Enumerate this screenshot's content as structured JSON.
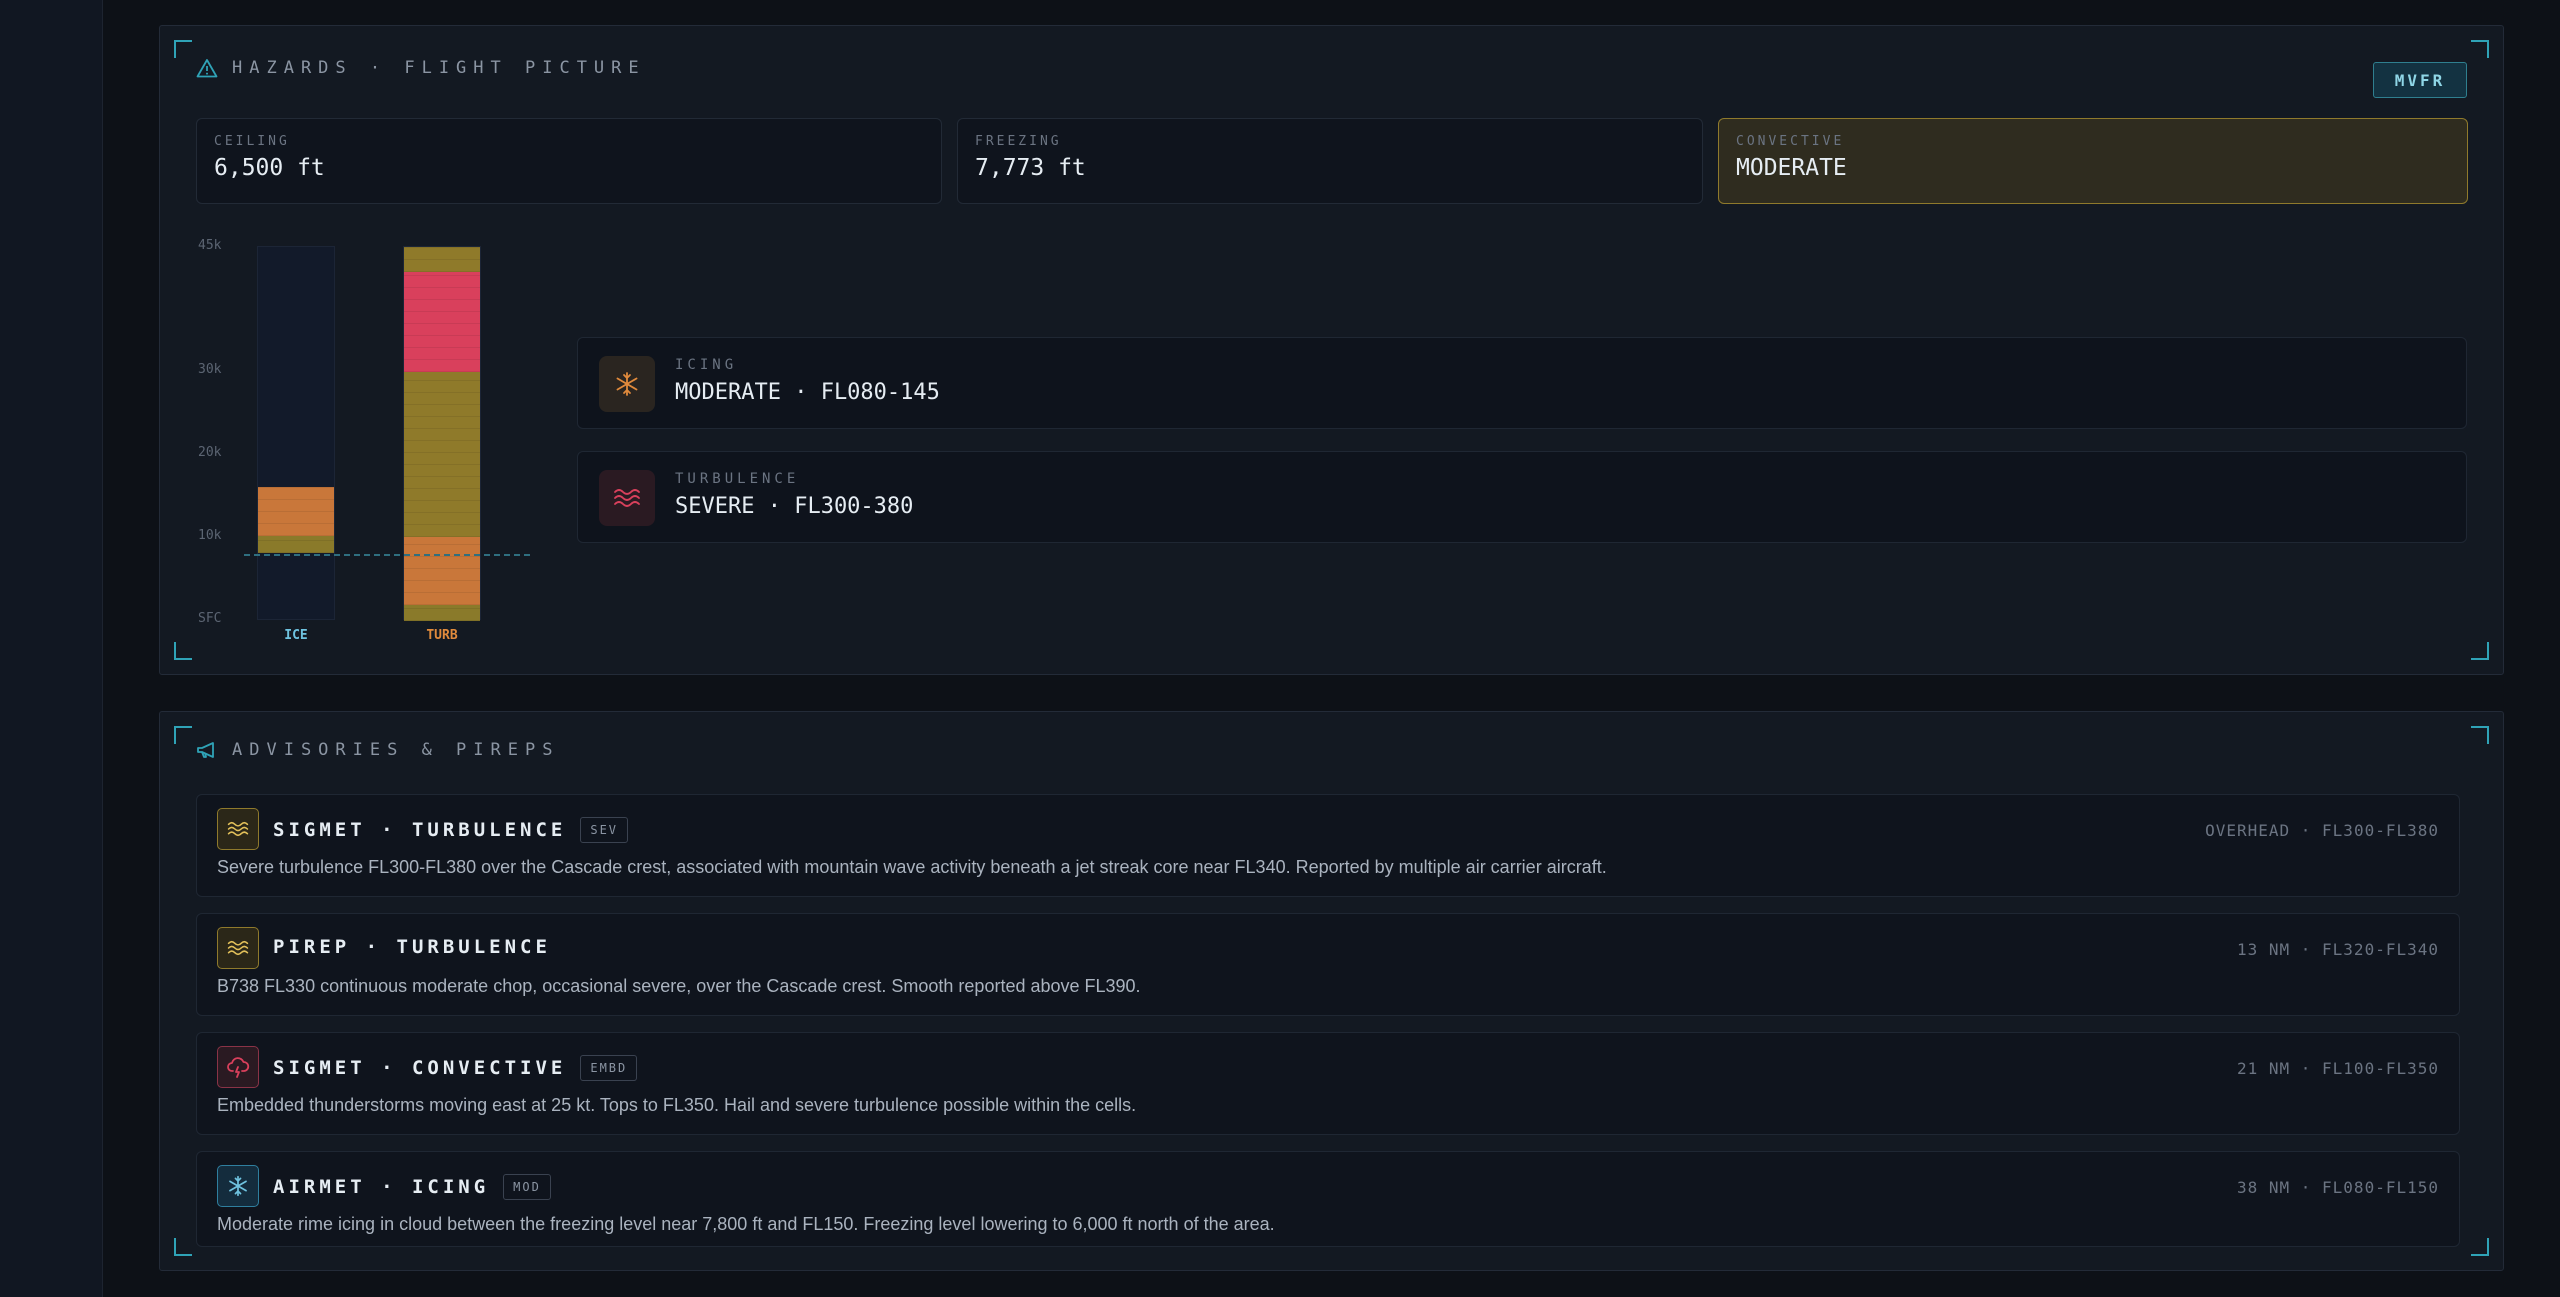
{
  "hazards": {
    "title": "HAZARDS · FLIGHT PICTURE",
    "flight_category": "MVFR",
    "stats": [
      {
        "label": "CEILING",
        "value": "6,500 ft"
      },
      {
        "label": "FREEZING",
        "value": "7,773 ft"
      },
      {
        "label": "CONVECTIVE",
        "value": "MODERATE"
      }
    ],
    "altitude_labels": [
      "45k",
      "30k",
      "20k",
      "10k",
      "SFC"
    ],
    "bars": [
      {
        "label": "ICE",
        "color": "#6fc3e0"
      },
      {
        "label": "TURB",
        "color": "#e08a3c"
      }
    ],
    "icing": {
      "label": "ICING",
      "value": "MODERATE · FL080-145",
      "icon": "snowflake-icon"
    },
    "turbulence": {
      "label": "TURBULENCE",
      "value": "SEVERE · FL300-380",
      "icon": "waves-icon"
    }
  },
  "advisories": {
    "title": "ADVISORIES & PIREPS",
    "items": [
      {
        "title": "SIGMET · TURBULENCE",
        "tag": "SEV",
        "icon": "waves-icon",
        "meta": "OVERHEAD · FL300-FL380",
        "body": "Severe turbulence FL300-FL380 over the Cascade crest, associated with mountain wave activity beneath a jet streak core near FL340. Reported by multiple air carrier aircraft."
      },
      {
        "title": "PIREP · TURBULENCE",
        "tag": "",
        "icon": "waves-icon",
        "meta": "13 NM · FL320-FL340",
        "body": "B738 FL330 continuous moderate chop, occasional severe, over the Cascade crest. Smooth reported above FL390."
      },
      {
        "title": "SIGMET · CONVECTIVE",
        "tag": "EMBD",
        "icon": "storm-cloud-icon",
        "meta": "21 NM · FL100-FL350",
        "body": "Embedded thunderstorms moving east at 25 kt. Tops to FL350. Hail and severe turbulence possible within the cells."
      },
      {
        "title": "AIRMET · ICING",
        "tag": "MOD",
        "icon": "snowflake-icon",
        "meta": "38 NM · FL080-FL150",
        "body": "Moderate rime icing in cloud between the freezing level near 7,800 ft and FL150. Freezing level lowering to 6,000 ft north of the area."
      }
    ]
  }
}
